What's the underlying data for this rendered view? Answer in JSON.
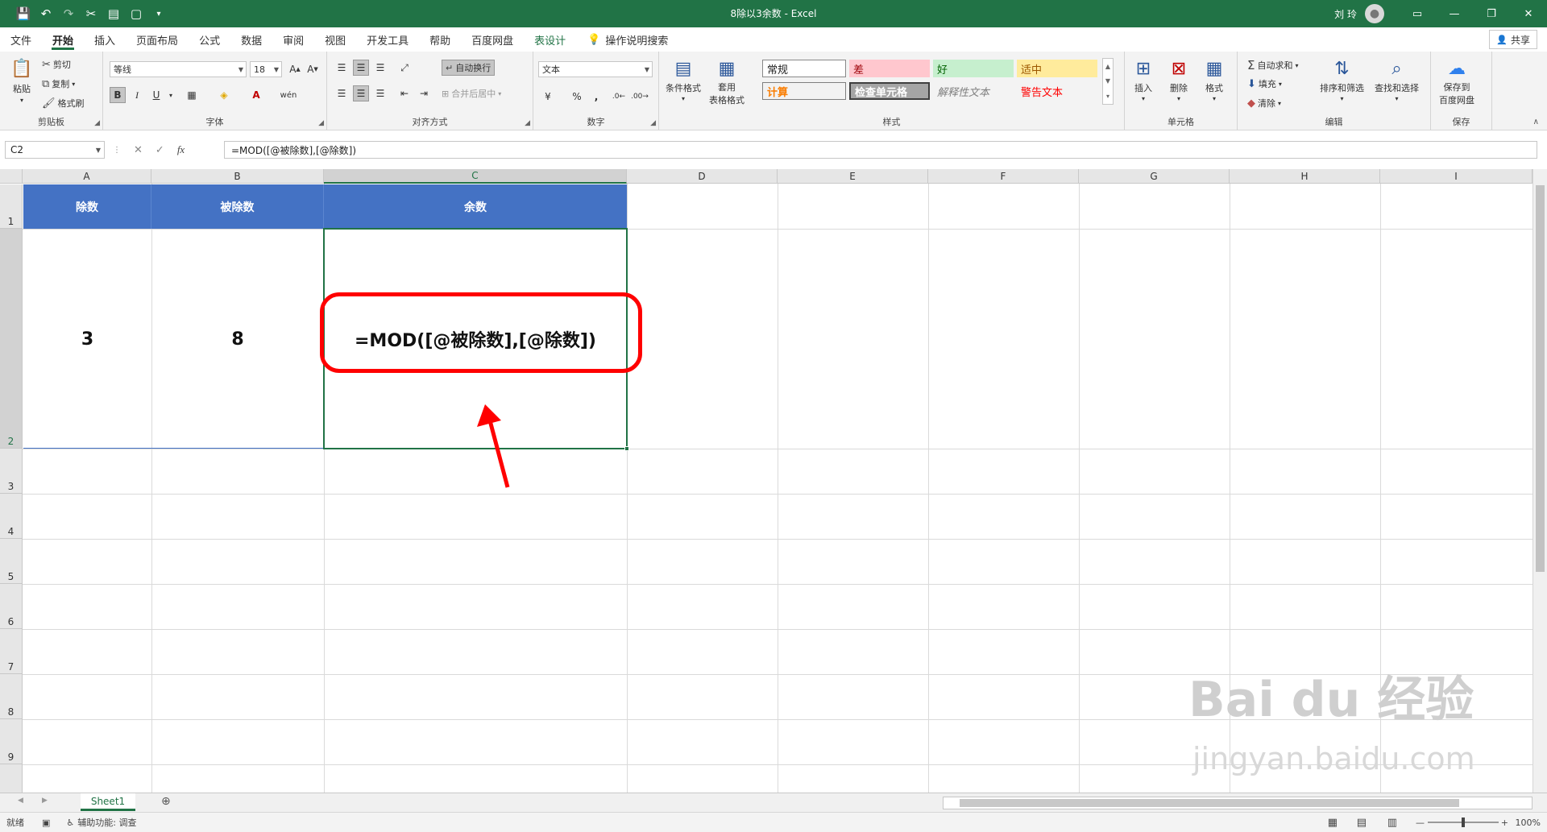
{
  "window": {
    "title": "8除以3余数 - Excel",
    "user": "刘 玲"
  },
  "tabs": [
    "文件",
    "开始",
    "插入",
    "页面布局",
    "公式",
    "数据",
    "审阅",
    "视图",
    "开发工具",
    "帮助",
    "百度网盘",
    "表设计"
  ],
  "tab_search": "操作说明搜索",
  "share_label": "共享",
  "ribbon": {
    "clipboard": {
      "paste": "粘贴",
      "cut": "剪切",
      "copy": "复制",
      "format_painter": "格式刷",
      "label": "剪贴板"
    },
    "font": {
      "name": "等线",
      "size": "18",
      "bold": "B",
      "italic": "I",
      "underline": "U",
      "label": "字体"
    },
    "alignment": {
      "wrap_text": "自动换行",
      "merge_center": "合并后居中",
      "label": "对齐方式"
    },
    "number": {
      "format": "文本",
      "percent": "%",
      "comma": ",",
      "label": "数字"
    },
    "styles": {
      "conditional": "条件格式",
      "table_format_1": "套用",
      "table_format_2": "表格格式",
      "normal": "常规",
      "bad": "差",
      "good": "好",
      "neutral": "适中",
      "calculation": "计算",
      "check_cell": "检查单元格",
      "explanatory": "解释性文本",
      "warning": "警告文本",
      "label": "样式"
    },
    "cells": {
      "insert": "插入",
      "delete": "删除",
      "format": "格式",
      "label": "单元格"
    },
    "editing": {
      "autosum": "自动求和",
      "fill": "填充",
      "clear": "清除",
      "sort_filter": "排序和筛选",
      "find_select": "查找和选择",
      "label": "编辑"
    },
    "save": {
      "save_to_1": "保存到",
      "save_to_2": "百度网盘",
      "label": "保存"
    }
  },
  "formula_bar": {
    "name_box": "C2",
    "formula": "=MOD([@被除数],[@除数])"
  },
  "columns": [
    "A",
    "B",
    "C",
    "D",
    "E",
    "F",
    "G",
    "H",
    "I"
  ],
  "rows": [
    "1",
    "2",
    "3",
    "4",
    "5",
    "6",
    "7",
    "8",
    "9"
  ],
  "table": {
    "headers": [
      "除数",
      "被除数",
      "余数"
    ],
    "row2": [
      "3",
      "8",
      "=MOD([@被除数],[@除数])"
    ]
  },
  "sheet_tab": "Sheet1",
  "status": {
    "ready": "就绪",
    "accessibility": "辅助功能: 调查",
    "zoom": "100%"
  },
  "watermark": {
    "main": "Bai du 经验",
    "sub": "jingyan.baidu.com"
  },
  "colors": {
    "brand": "#217346",
    "table_header": "#4472c4",
    "callout": "#ff0000"
  }
}
